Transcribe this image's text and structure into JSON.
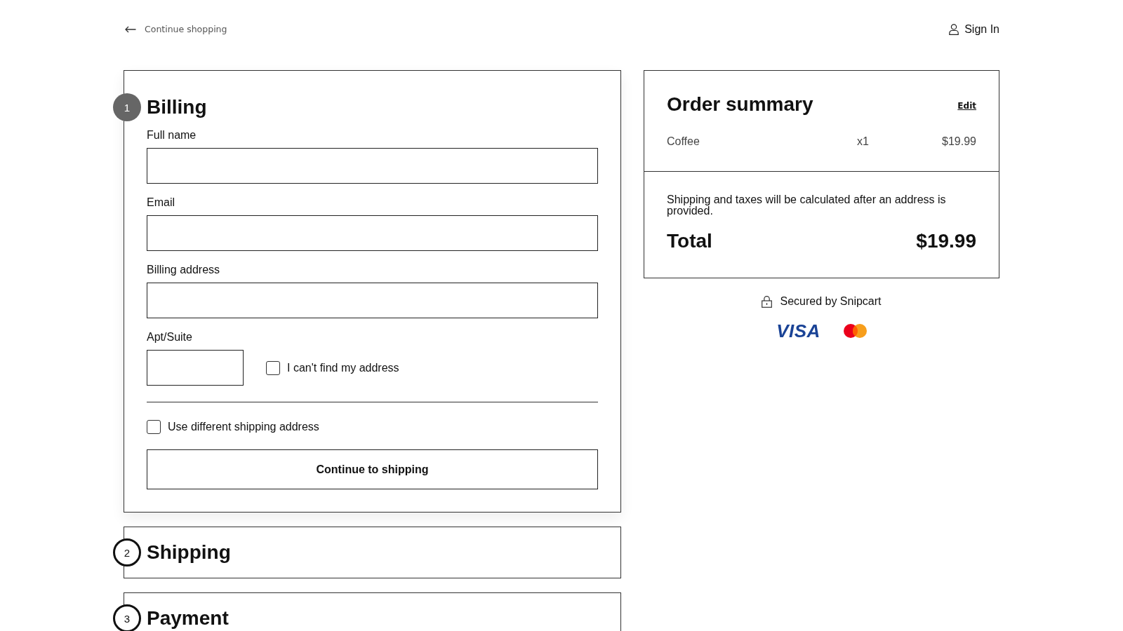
{
  "header": {
    "back_link": "Continue shopping",
    "sign_in_link": "Sign In"
  },
  "steps": [
    {
      "number": "1",
      "title": "Billing",
      "active": true,
      "form": {
        "fields": [
          {
            "label": "Full name"
          },
          {
            "label": "Email"
          },
          {
            "label": "Billing address"
          }
        ],
        "apt_field": {
          "label": "Apt/Suite"
        },
        "address_checkbox": {
          "label": "I can't find my address",
          "checked": false
        },
        "shipping_checkbox": {
          "label": "Use different shipping address",
          "checked": false
        },
        "submit_button": "Continue to shipping"
      }
    },
    {
      "number": "2",
      "title": "Shipping",
      "active": false
    },
    {
      "number": "3",
      "title": "Payment",
      "active": false
    }
  ],
  "order_summary": {
    "title": "Order summary",
    "edit_link": "Edit",
    "items": [
      {
        "name": "Coffee",
        "quantity": "x1",
        "price": "$19.99"
      }
    ],
    "note": "Shipping and taxes will be calculated after an address is provided.",
    "total_label": "Total",
    "total_value": "$19.99"
  },
  "secure_note": "Secured by Snipcart",
  "payment_logos": [
    {
      "kind": "visa",
      "text": "VISA"
    },
    {
      "kind": "mastercard"
    }
  ]
}
